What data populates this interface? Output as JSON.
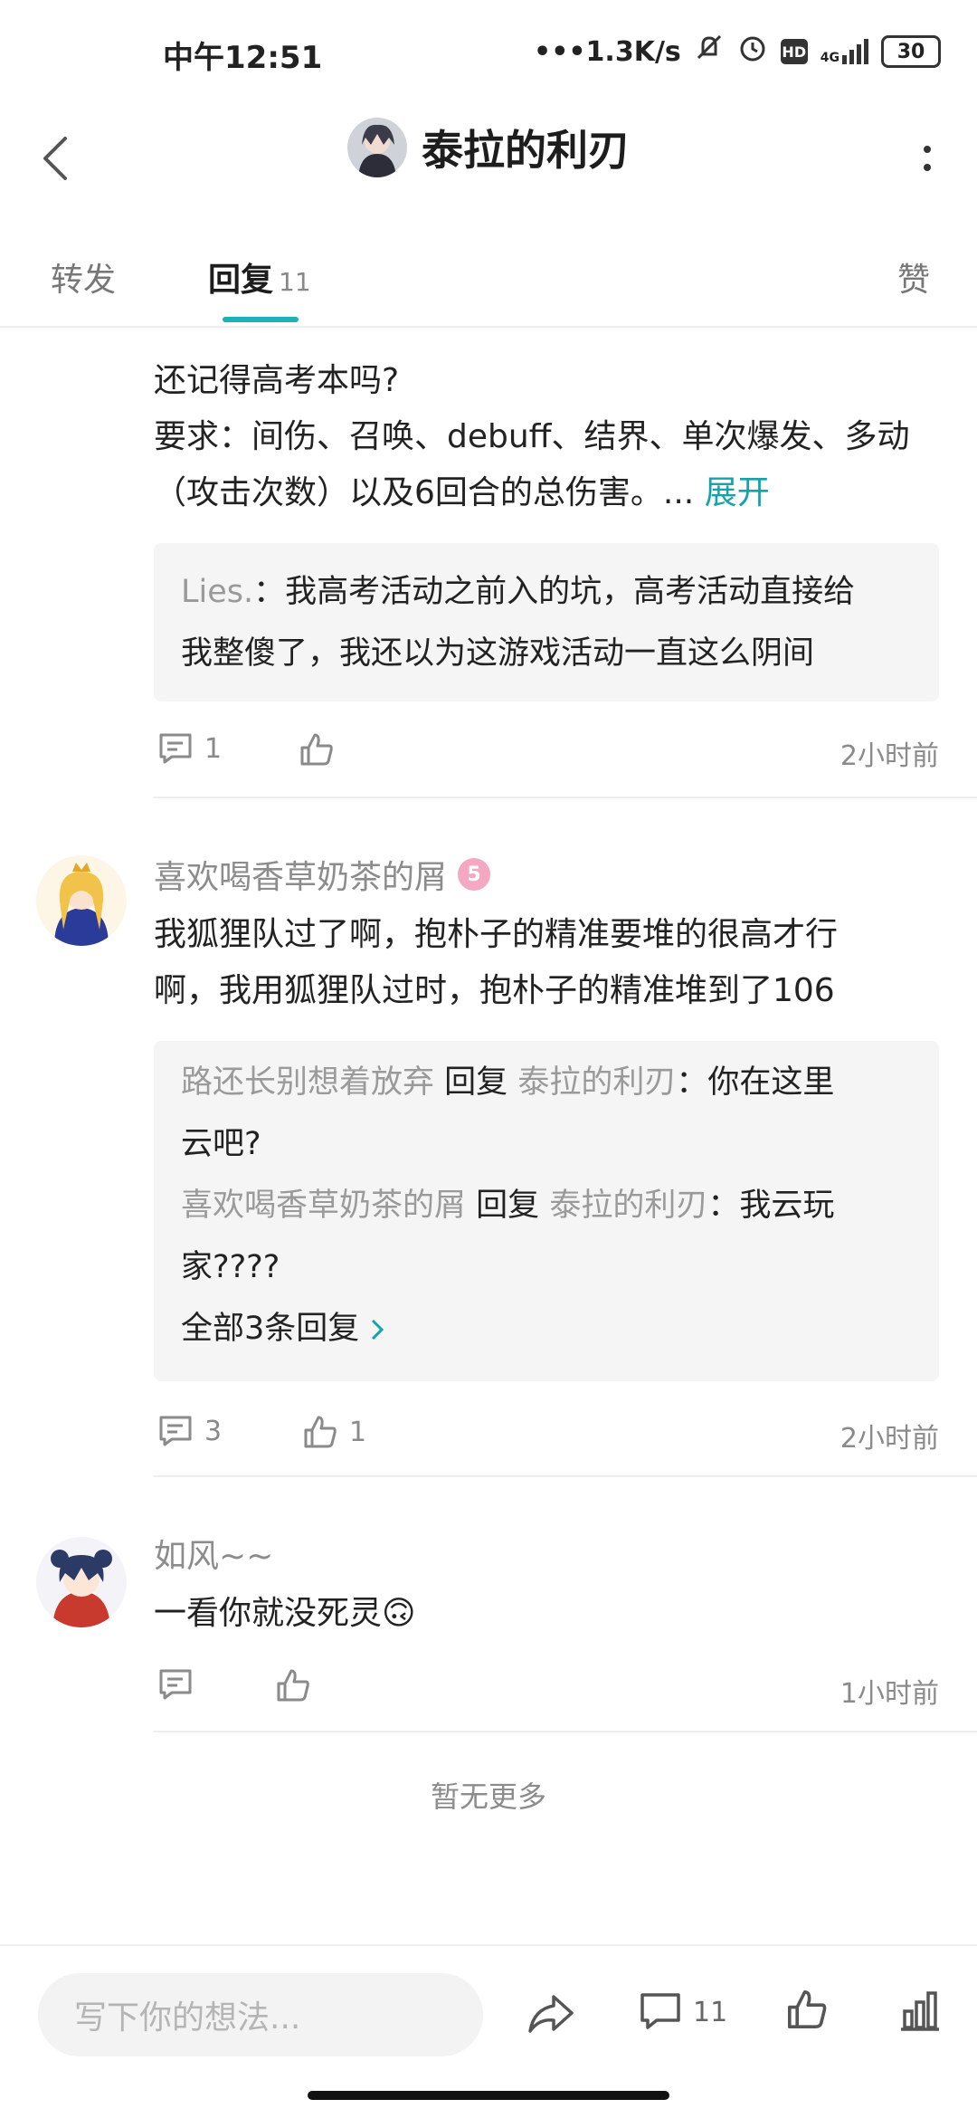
{
  "status_bar": {
    "time": "中午12:51",
    "speed": "1.3K/s",
    "network": "4G",
    "battery": "30"
  },
  "header": {
    "title": "泰拉的利刃"
  },
  "tabs": {
    "repost": "转发",
    "reply": "回复",
    "reply_count": "11",
    "like": "赞"
  },
  "post": {
    "line1": "还记得高考本吗?",
    "line2": "要求：间伤、召唤、debuff、结界、单次爆发、多动",
    "line3": "（攻击次数）以及6回合的总伤害。...",
    "expand": "展开",
    "quote_user": "Lies.",
    "quote_sep": "：",
    "quote_line1": "我高考活动之前入的坑，高考活动直接给",
    "quote_line2": "我整傻了，我还以为这游戏活动一直这么阴间",
    "comment_count": "1",
    "time": "2小时前"
  },
  "comments": [
    {
      "username": "喜欢喝香草奶茶的屑",
      "level": "5",
      "line1": "我狐狸队过了啊，抱朴子的精准要堆的很高才行",
      "line2": "啊，我用狐狸队过时，抱朴子的精准堆到了106",
      "replies": [
        {
          "from": "路还长别想着放弃",
          "verb": "回复",
          "to": "泰拉的利刃",
          "sep": "：",
          "text1": "你在这里",
          "text2": "云吧?"
        },
        {
          "from": "喜欢喝香草奶茶的屑",
          "verb": "回复",
          "to": "泰拉的利刃",
          "sep": "：",
          "text1": "我云玩",
          "text2": "家????"
        }
      ],
      "all_replies": "全部3条回复",
      "comment_count": "3",
      "like_count": "1",
      "time": "2小时前"
    },
    {
      "username": "如风~~",
      "line1": "一看你就没死灵",
      "emoji": "🙃",
      "time": "1小时前"
    }
  ],
  "no_more": "暂无更多",
  "bottom_bar": {
    "placeholder": "写下你的想法...",
    "comment_count": "11"
  },
  "icons": [
    "back-icon",
    "more-icon",
    "comment-icon",
    "like-icon",
    "share-icon",
    "chart-icon"
  ],
  "colors": {
    "accent": "#14a3ab",
    "muted": "#9a9a9a"
  }
}
